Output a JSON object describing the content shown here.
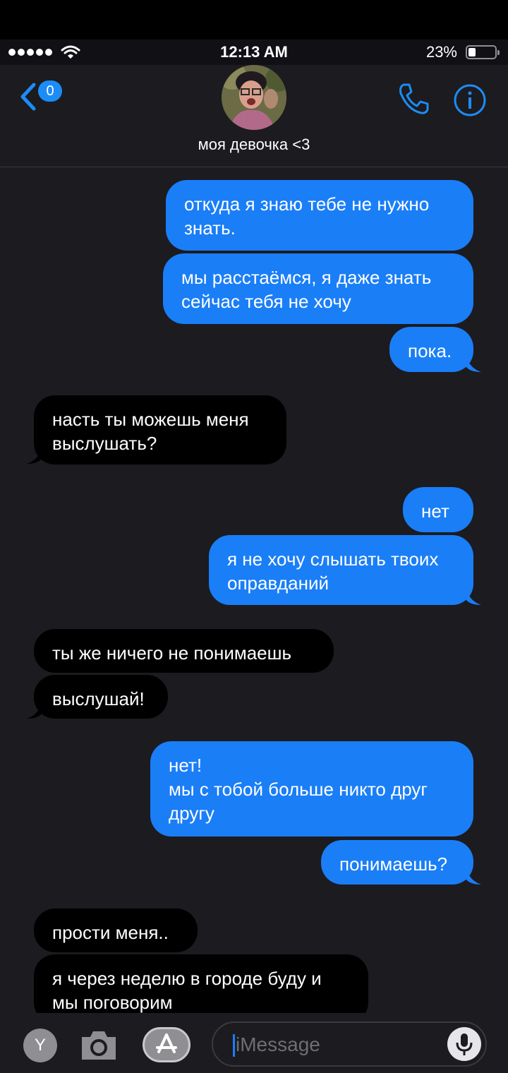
{
  "status": {
    "time": "12:13 AM",
    "battery": "23%"
  },
  "header": {
    "back_badge": "0",
    "contact_name": "моя девочка <3"
  },
  "messages": [
    {
      "from": "me",
      "text": "откуда я знаю тебе не нужно\nзнать."
    },
    {
      "from": "me",
      "text": "мы расстаёмся, я даже знать\nсейчас тебя не хочу"
    },
    {
      "from": "me",
      "text": "пока."
    },
    {
      "from": "them",
      "text": "насть ты можешь меня\nвыслушать?"
    },
    {
      "from": "me",
      "text": "нет"
    },
    {
      "from": "me",
      "text": "я не хочу слышать твоих\nоправданий"
    },
    {
      "from": "them",
      "text": "ты же ничего не понимаешь"
    },
    {
      "from": "them",
      "text": "выслушай!"
    },
    {
      "from": "me",
      "text": "нет!\nмы с тобой больше никто друг\nдругу"
    },
    {
      "from": "me",
      "text": "понимаешь?"
    },
    {
      "from": "them",
      "text": "прости меня.."
    },
    {
      "from": "them",
      "text": "я через неделю в городе буду и\nмы поговорим"
    }
  ],
  "input": {
    "placeholder": "iMessage",
    "app_button_label": "Y"
  },
  "colors": {
    "sent": "#1a7ef7",
    "received": "#000000",
    "accent": "#1c8cf6",
    "background": "#1c1b20"
  }
}
